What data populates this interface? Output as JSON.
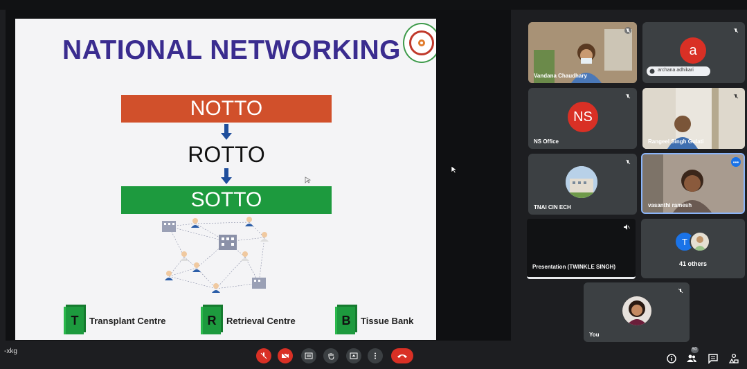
{
  "window": {
    "title": ""
  },
  "meeting": {
    "code": "-xkg"
  },
  "slide": {
    "title": "NATIONAL NETWORKING",
    "boxes": {
      "notto": "NOTTO",
      "rotto": "ROTTO",
      "sotto": "SOTTO"
    },
    "legend": [
      {
        "letter": "T",
        "label": "Transplant Centre"
      },
      {
        "letter": "R",
        "label": "Retrieval Centre"
      },
      {
        "letter": "B",
        "label": "Tissue Bank"
      }
    ]
  },
  "participants": [
    {
      "name": "Vandana Chaudhary"
    },
    {
      "name": "archana adhikari",
      "initial": "a",
      "color": "#d93025"
    },
    {
      "name": "NS Office",
      "initial": "NS",
      "color": "#d93025"
    },
    {
      "name": "Rangeel Singh Gulati"
    },
    {
      "name": "TNAI CIN ECH"
    },
    {
      "name": "vasanthi ramesh"
    },
    {
      "name": "Presentation (TWINKLE SINGH)"
    },
    {
      "name": "41 others",
      "initial": "T"
    },
    {
      "name": "You"
    }
  ],
  "controls": {
    "icons": [
      "mic-off-icon",
      "camera-off-icon",
      "captions-icon",
      "raise-hand-icon",
      "present-icon",
      "more-icon",
      "end-call-icon"
    ],
    "right_icons": [
      "info-icon",
      "people-icon",
      "chat-icon",
      "activities-icon"
    ],
    "people_badge": "50"
  },
  "colors": {
    "accent_red": "#d93025",
    "notto": "#d1502b",
    "sotto": "#1d9a3e",
    "title": "#3a2c8f"
  }
}
